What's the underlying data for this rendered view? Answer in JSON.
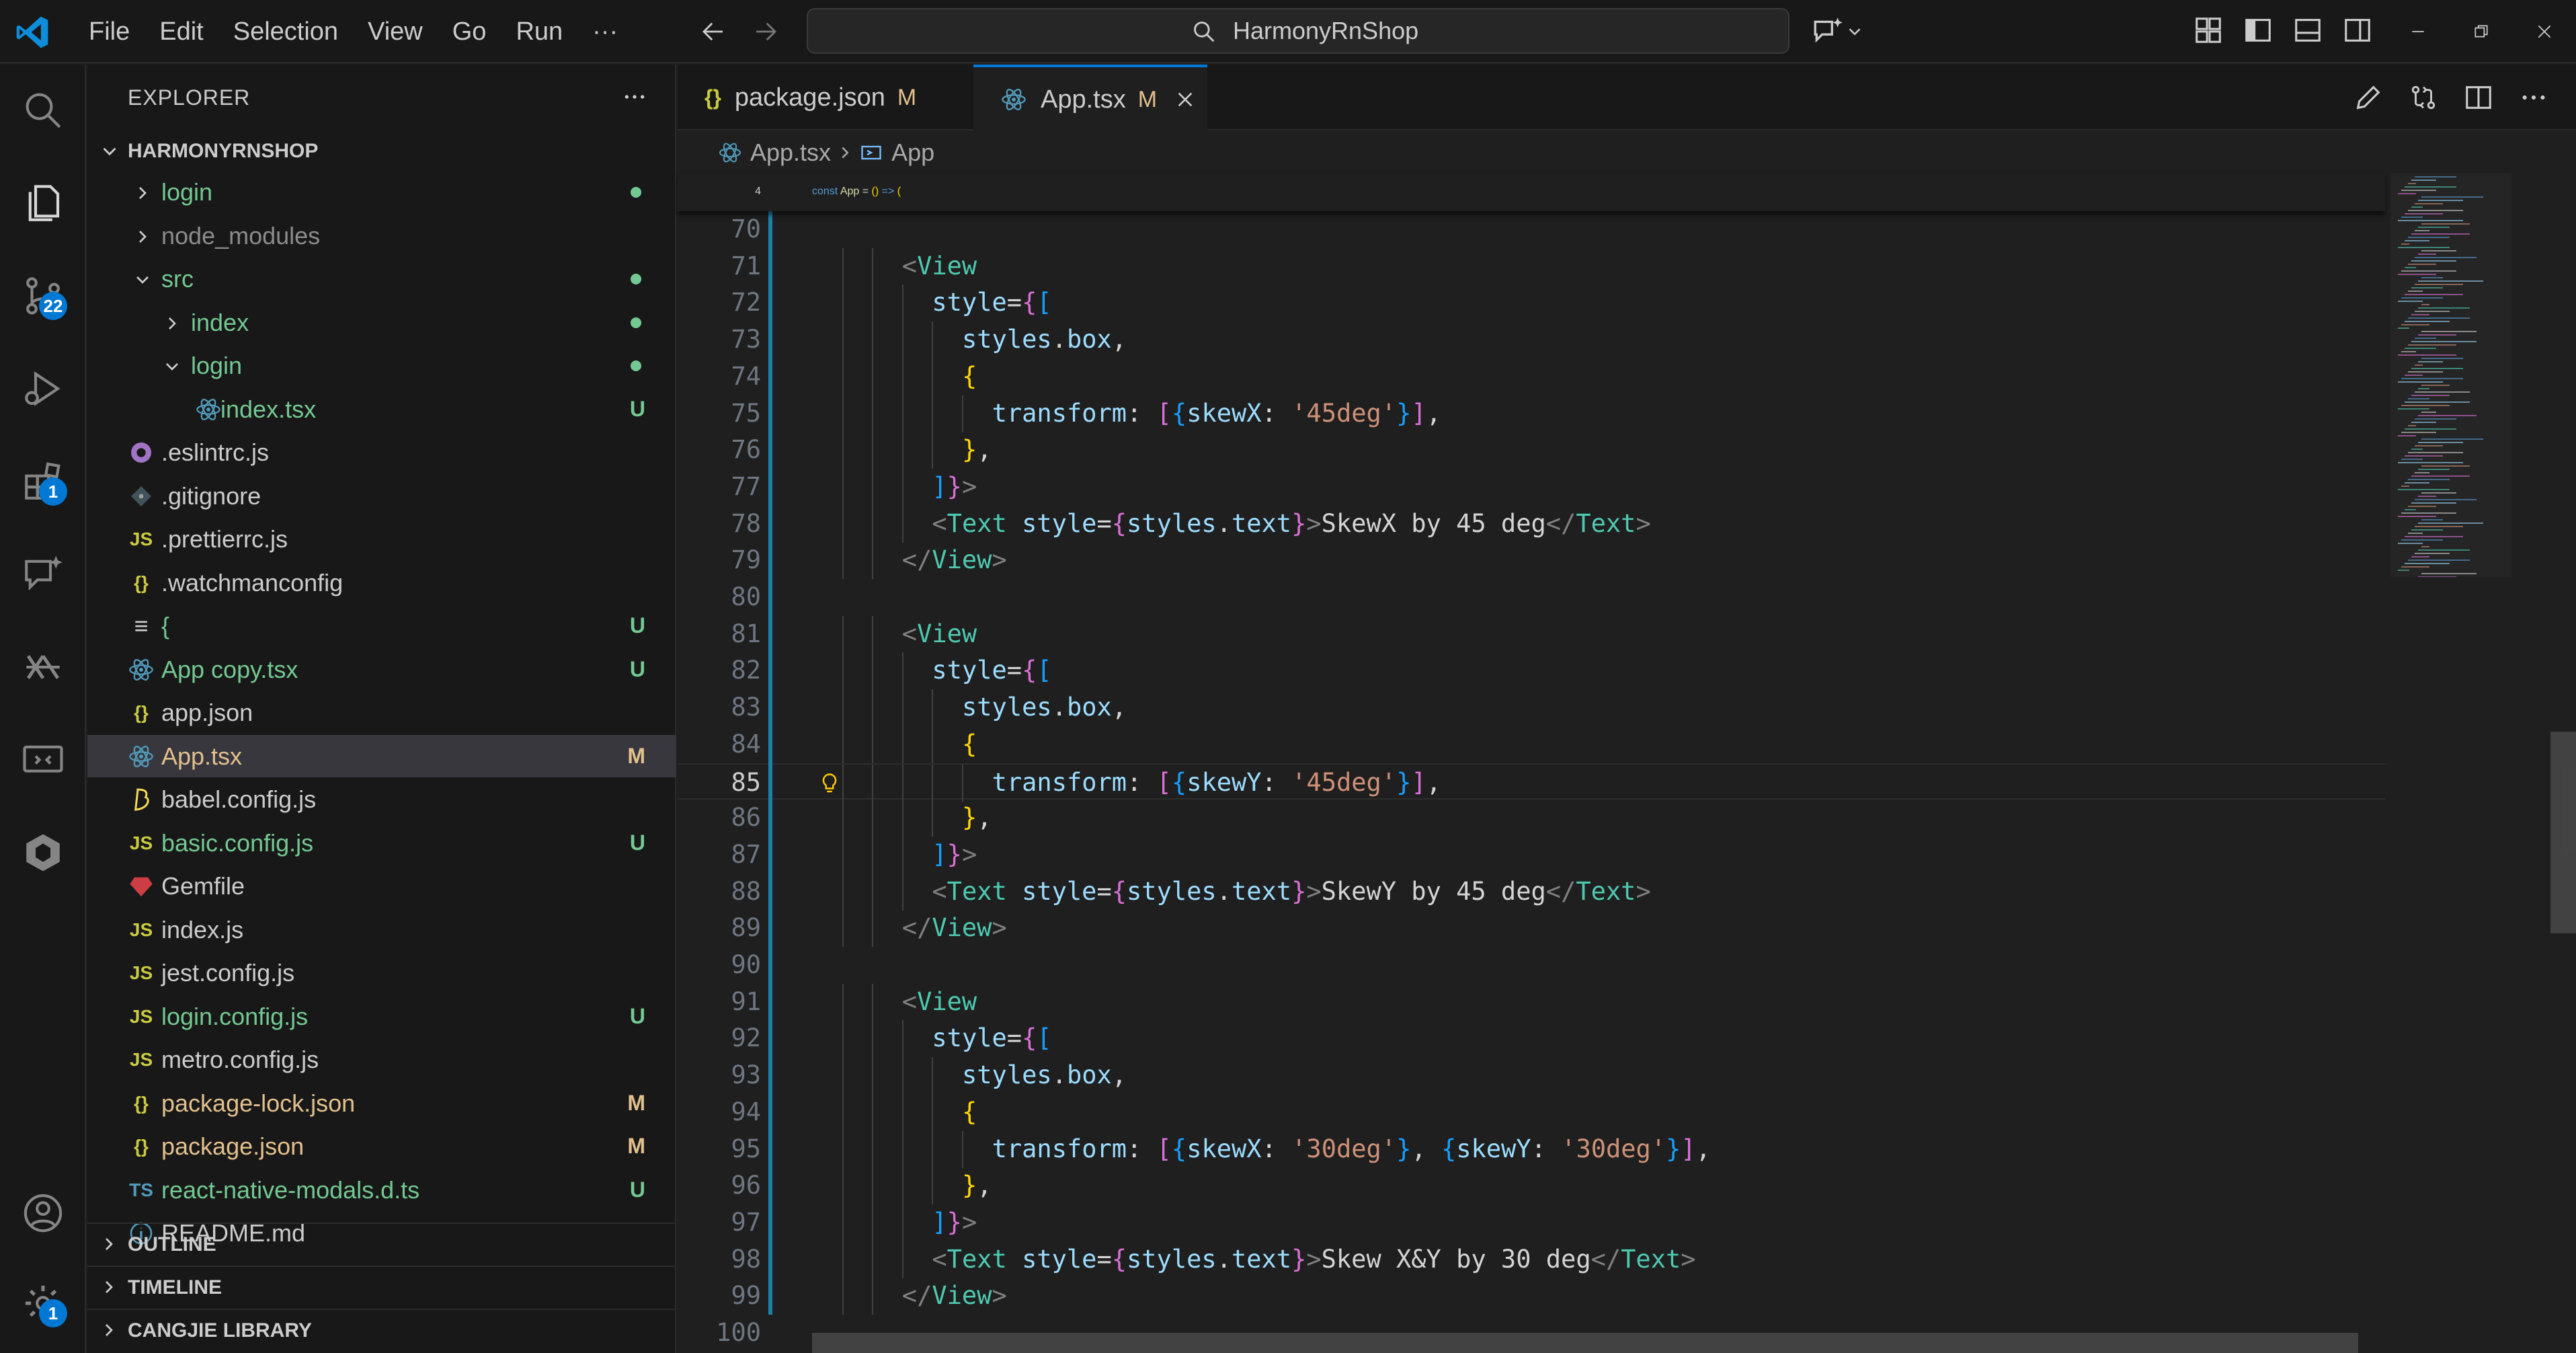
{
  "menu": [
    "File",
    "Edit",
    "Selection",
    "View",
    "Go",
    "Run",
    "···"
  ],
  "command_center": {
    "text": "HarmonyRnShop"
  },
  "activity_badges": {
    "source_control": "22",
    "extensions": "1",
    "settings": "1"
  },
  "sidebar": {
    "title": "EXPLORER",
    "root": "HARMONYRNSHOP",
    "items": [
      {
        "label": "login",
        "kind": "folder",
        "depth": 1,
        "icon": "chevron-right",
        "color": "#73c991",
        "dot": "#73c991"
      },
      {
        "label": "node_modules",
        "kind": "folder",
        "depth": 1,
        "icon": "chevron-right",
        "color": "#8c8c8c"
      },
      {
        "label": "src",
        "kind": "folder",
        "depth": 1,
        "icon": "chevron-down",
        "color": "#73c991",
        "dot": "#73c991"
      },
      {
        "label": "index",
        "kind": "folder",
        "depth": 2,
        "icon": "chevron-right",
        "color": "#73c991",
        "dot": "#73c991"
      },
      {
        "label": "login",
        "kind": "folder",
        "depth": 2,
        "icon": "chevron-down",
        "color": "#73c991",
        "dot": "#73c991"
      },
      {
        "label": "index.tsx",
        "kind": "file",
        "depth": 3,
        "icon": "react",
        "color": "#73c991",
        "badge": "U"
      },
      {
        "label": ".eslintrc.js",
        "kind": "file",
        "depth": 1,
        "icon": "eslint",
        "color": "#cccccc"
      },
      {
        "label": ".gitignore",
        "kind": "file",
        "depth": 1,
        "icon": "git",
        "color": "#cccccc"
      },
      {
        "label": ".prettierrc.js",
        "kind": "file",
        "depth": 1,
        "icon": "js",
        "color": "#cccccc"
      },
      {
        "label": ".watchmanconfig",
        "kind": "file",
        "depth": 1,
        "icon": "json",
        "color": "#cccccc"
      },
      {
        "label": "{",
        "kind": "file",
        "depth": 1,
        "icon": "text",
        "color": "#73c991",
        "badge": "U"
      },
      {
        "label": "App copy.tsx",
        "kind": "file",
        "depth": 1,
        "icon": "react",
        "color": "#73c991",
        "badge": "U"
      },
      {
        "label": "app.json",
        "kind": "file",
        "depth": 1,
        "icon": "json",
        "color": "#cccccc"
      },
      {
        "label": "App.tsx",
        "kind": "file",
        "depth": 1,
        "icon": "react",
        "color": "#e2c08d",
        "badge": "M",
        "selected": true
      },
      {
        "label": "babel.config.js",
        "kind": "file",
        "depth": 1,
        "icon": "babel",
        "color": "#cccccc"
      },
      {
        "label": "basic.config.js",
        "kind": "file",
        "depth": 1,
        "icon": "js",
        "color": "#73c991",
        "badge": "U"
      },
      {
        "label": "Gemfile",
        "kind": "file",
        "depth": 1,
        "icon": "ruby",
        "color": "#cccccc"
      },
      {
        "label": "index.js",
        "kind": "file",
        "depth": 1,
        "icon": "js",
        "color": "#cccccc"
      },
      {
        "label": "jest.config.js",
        "kind": "file",
        "depth": 1,
        "icon": "js",
        "color": "#cccccc"
      },
      {
        "label": "login.config.js",
        "kind": "file",
        "depth": 1,
        "icon": "js",
        "color": "#73c991",
        "badge": "U"
      },
      {
        "label": "metro.config.js",
        "kind": "file",
        "depth": 1,
        "icon": "js",
        "color": "#cccccc"
      },
      {
        "label": "package-lock.json",
        "kind": "file",
        "depth": 1,
        "icon": "json",
        "color": "#e2c08d",
        "badge": "M"
      },
      {
        "label": "package.json",
        "kind": "file",
        "depth": 1,
        "icon": "json",
        "color": "#e2c08d",
        "badge": "M"
      },
      {
        "label": "react-native-modals.d.ts",
        "kind": "file",
        "depth": 1,
        "icon": "ts",
        "color": "#73c991",
        "badge": "U"
      },
      {
        "label": "README.md",
        "kind": "file",
        "depth": 1,
        "icon": "info",
        "color": "#cccccc"
      }
    ],
    "sections": [
      "OUTLINE",
      "TIMELINE",
      "CANGJIE LIBRARY"
    ]
  },
  "tabs": [
    {
      "label": "package.json",
      "icon": "{}",
      "modified": "M",
      "active": false
    },
    {
      "label": "App.tsx",
      "icon": "react",
      "modified": "M",
      "active": true
    }
  ],
  "breadcrumb": {
    "file": "App.tsx",
    "symbol": "App"
  },
  "sticky_line": {
    "num": "4",
    "tokens": [
      [
        "k",
        "const "
      ],
      [
        "fn",
        "App"
      ],
      [
        "p",
        " = "
      ],
      [
        "b1",
        "()"
      ],
      [
        "p",
        " "
      ],
      [
        "k",
        "=>"
      ],
      [
        "p",
        " "
      ],
      [
        "b1",
        "("
      ]
    ]
  },
  "code_lines": [
    {
      "num": "70",
      "indent": 0,
      "tokens": []
    },
    {
      "num": "71",
      "indent": 3,
      "tokens": [
        [
          "pk",
          "<"
        ],
        [
          "tag",
          "View"
        ]
      ]
    },
    {
      "num": "72",
      "indent": 4,
      "tokens": [
        [
          "at",
          "style"
        ],
        [
          "p",
          "="
        ],
        [
          "b2",
          "{"
        ],
        [
          "b3",
          "["
        ]
      ]
    },
    {
      "num": "73",
      "indent": 5,
      "tokens": [
        [
          "v",
          "styles"
        ],
        [
          "p",
          "."
        ],
        [
          "v",
          "box"
        ],
        [
          "p",
          ","
        ]
      ]
    },
    {
      "num": "74",
      "indent": 5,
      "tokens": [
        [
          "b1",
          "{"
        ]
      ]
    },
    {
      "num": "75",
      "indent": 6,
      "tokens": [
        [
          "v",
          "transform"
        ],
        [
          "p",
          ": "
        ],
        [
          "b2",
          "["
        ],
        [
          "b3",
          "{"
        ],
        [
          "v",
          "skewX"
        ],
        [
          "p",
          ": "
        ],
        [
          "s",
          "'45deg'"
        ],
        [
          "b3",
          "}"
        ],
        [
          "b2",
          "]"
        ],
        [
          "p",
          ","
        ]
      ]
    },
    {
      "num": "76",
      "indent": 5,
      "tokens": [
        [
          "b1",
          "}"
        ],
        [
          "p",
          ","
        ]
      ]
    },
    {
      "num": "77",
      "indent": 4,
      "tokens": [
        [
          "b3",
          "]"
        ],
        [
          "b2",
          "}"
        ],
        [
          "pk",
          ">"
        ]
      ]
    },
    {
      "num": "78",
      "indent": 4,
      "tokens": [
        [
          "pk",
          "<"
        ],
        [
          "tag",
          "Text"
        ],
        [
          "p",
          " "
        ],
        [
          "at",
          "style"
        ],
        [
          "p",
          "="
        ],
        [
          "b2",
          "{"
        ],
        [
          "v",
          "styles"
        ],
        [
          "p",
          "."
        ],
        [
          "v",
          "text"
        ],
        [
          "b2",
          "}"
        ],
        [
          "pk",
          ">"
        ],
        [
          "txt",
          "SkewX by 45 deg"
        ],
        [
          "pk",
          "</"
        ],
        [
          "tag",
          "Text"
        ],
        [
          "pk",
          ">"
        ]
      ]
    },
    {
      "num": "79",
      "indent": 3,
      "tokens": [
        [
          "pk",
          "</"
        ],
        [
          "tag",
          "View"
        ],
        [
          "pk",
          ">"
        ]
      ]
    },
    {
      "num": "80",
      "indent": 0,
      "tokens": []
    },
    {
      "num": "81",
      "indent": 3,
      "tokens": [
        [
          "pk",
          "<"
        ],
        [
          "tag",
          "View"
        ]
      ]
    },
    {
      "num": "82",
      "indent": 4,
      "tokens": [
        [
          "at",
          "style"
        ],
        [
          "p",
          "="
        ],
        [
          "b2",
          "{"
        ],
        [
          "b3",
          "["
        ]
      ]
    },
    {
      "num": "83",
      "indent": 5,
      "tokens": [
        [
          "v",
          "styles"
        ],
        [
          "p",
          "."
        ],
        [
          "v",
          "box"
        ],
        [
          "p",
          ","
        ]
      ]
    },
    {
      "num": "84",
      "indent": 5,
      "tokens": [
        [
          "b1",
          "{"
        ]
      ]
    },
    {
      "num": "85",
      "indent": 6,
      "tokens": [
        [
          "v",
          "transform"
        ],
        [
          "p",
          ": "
        ],
        [
          "b2",
          "["
        ],
        [
          "b3",
          "{"
        ],
        [
          "v",
          "skewY"
        ],
        [
          "p",
          ": "
        ],
        [
          "s",
          "'45deg'"
        ],
        [
          "b3",
          "}"
        ],
        [
          "b2",
          "]"
        ],
        [
          "p",
          ","
        ]
      ],
      "current": true,
      "bulb": true
    },
    {
      "num": "86",
      "indent": 5,
      "tokens": [
        [
          "b1",
          "}"
        ],
        [
          "p",
          ","
        ]
      ]
    },
    {
      "num": "87",
      "indent": 4,
      "tokens": [
        [
          "b3",
          "]"
        ],
        [
          "b2",
          "}"
        ],
        [
          "pk",
          ">"
        ]
      ]
    },
    {
      "num": "88",
      "indent": 4,
      "tokens": [
        [
          "pk",
          "<"
        ],
        [
          "tag",
          "Text"
        ],
        [
          "p",
          " "
        ],
        [
          "at",
          "style"
        ],
        [
          "p",
          "="
        ],
        [
          "b2",
          "{"
        ],
        [
          "v",
          "styles"
        ],
        [
          "p",
          "."
        ],
        [
          "v",
          "text"
        ],
        [
          "b2",
          "}"
        ],
        [
          "pk",
          ">"
        ],
        [
          "txt",
          "SkewY by 45 deg"
        ],
        [
          "pk",
          "</"
        ],
        [
          "tag",
          "Text"
        ],
        [
          "pk",
          ">"
        ]
      ]
    },
    {
      "num": "89",
      "indent": 3,
      "tokens": [
        [
          "pk",
          "</"
        ],
        [
          "tag",
          "View"
        ],
        [
          "pk",
          ">"
        ]
      ]
    },
    {
      "num": "90",
      "indent": 0,
      "tokens": []
    },
    {
      "num": "91",
      "indent": 3,
      "tokens": [
        [
          "pk",
          "<"
        ],
        [
          "tag",
          "View"
        ]
      ]
    },
    {
      "num": "92",
      "indent": 4,
      "tokens": [
        [
          "at",
          "style"
        ],
        [
          "p",
          "="
        ],
        [
          "b2",
          "{"
        ],
        [
          "b3",
          "["
        ]
      ]
    },
    {
      "num": "93",
      "indent": 5,
      "tokens": [
        [
          "v",
          "styles"
        ],
        [
          "p",
          "."
        ],
        [
          "v",
          "box"
        ],
        [
          "p",
          ","
        ]
      ]
    },
    {
      "num": "94",
      "indent": 5,
      "tokens": [
        [
          "b1",
          "{"
        ]
      ]
    },
    {
      "num": "95",
      "indent": 6,
      "tokens": [
        [
          "v",
          "transform"
        ],
        [
          "p",
          ": "
        ],
        [
          "b2",
          "["
        ],
        [
          "b3",
          "{"
        ],
        [
          "v",
          "skewX"
        ],
        [
          "p",
          ": "
        ],
        [
          "s",
          "'30deg'"
        ],
        [
          "b3",
          "}"
        ],
        [
          "p",
          ", "
        ],
        [
          "b3",
          "{"
        ],
        [
          "v",
          "skewY"
        ],
        [
          "p",
          ": "
        ],
        [
          "s",
          "'30deg'"
        ],
        [
          "b3",
          "}"
        ],
        [
          "b2",
          "]"
        ],
        [
          "p",
          ","
        ]
      ]
    },
    {
      "num": "96",
      "indent": 5,
      "tokens": [
        [
          "b1",
          "}"
        ],
        [
          "p",
          ","
        ]
      ]
    },
    {
      "num": "97",
      "indent": 4,
      "tokens": [
        [
          "b3",
          "]"
        ],
        [
          "b2",
          "}"
        ],
        [
          "pk",
          ">"
        ]
      ]
    },
    {
      "num": "98",
      "indent": 4,
      "tokens": [
        [
          "pk",
          "<"
        ],
        [
          "tag",
          "Text"
        ],
        [
          "p",
          " "
        ],
        [
          "at",
          "style"
        ],
        [
          "p",
          "="
        ],
        [
          "b2",
          "{"
        ],
        [
          "v",
          "styles"
        ],
        [
          "p",
          "."
        ],
        [
          "v",
          "text"
        ],
        [
          "b2",
          "}"
        ],
        [
          "pk",
          ">"
        ],
        [
          "txt",
          "Skew X&Y by 30 deg"
        ],
        [
          "pk",
          "</"
        ],
        [
          "tag",
          "Text"
        ],
        [
          "pk",
          ">"
        ]
      ]
    },
    {
      "num": "99",
      "indent": 3,
      "tokens": [
        [
          "pk",
          "</"
        ],
        [
          "tag",
          "View"
        ],
        [
          "pk",
          ">"
        ]
      ]
    },
    {
      "num": "100",
      "indent": 0,
      "tokens": []
    }
  ]
}
